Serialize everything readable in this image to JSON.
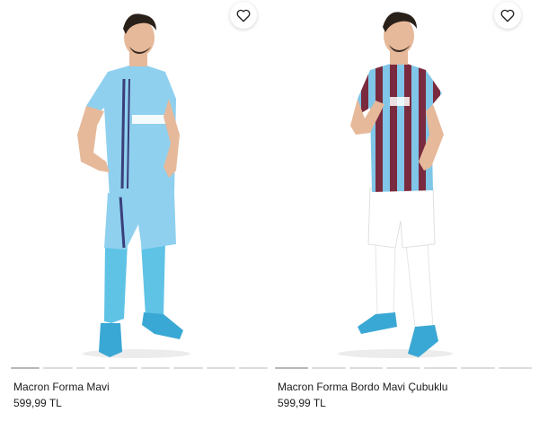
{
  "products": [
    {
      "name": "Macron Forma Mavi",
      "price": "599,99 TL",
      "colors": {
        "shirt": "#8fd0ef",
        "shorts": "#8fd0ef",
        "socks": "#5fc3e6",
        "stripe": "#3a3f7a",
        "boots": "#3aa8d4"
      }
    },
    {
      "name": "Macron Forma Bordo Mavi Çubuklu",
      "price": "599,99 TL",
      "colors": {
        "shirt_a": "#7a2a3e",
        "shirt_b": "#7fc6e8",
        "shorts": "#ffffff",
        "socks": "#ffffff",
        "boots": "#3aa8d4"
      }
    }
  ],
  "icons": {
    "favorite": "heart-outline-icon"
  },
  "gallery": {
    "slides": 8,
    "active": 1
  }
}
